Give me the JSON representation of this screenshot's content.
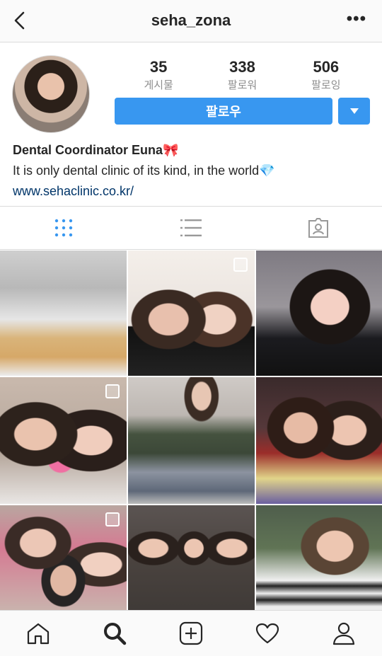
{
  "header": {
    "username": "seha_zona",
    "back_icon": "chevron-left-icon",
    "more_label": "•••"
  },
  "profile": {
    "stats": [
      {
        "value": "35",
        "label": "게시물"
      },
      {
        "value": "338",
        "label": "팔로워"
      },
      {
        "value": "506",
        "label": "팔로잉"
      }
    ],
    "follow_label": "팔로우",
    "name": "Dental Coordinator Euna🎀",
    "bio": "It is only dental clinic of its kind, in the world💎",
    "website": "www.sehaclinic.co.kr/"
  },
  "tabs": [
    {
      "icon": "grid-icon",
      "active": true
    },
    {
      "icon": "list-icon",
      "active": false
    },
    {
      "icon": "tagged-icon",
      "active": false
    }
  ],
  "posts": [
    {
      "multi": false
    },
    {
      "multi": true
    },
    {
      "multi": false
    },
    {
      "multi": true
    },
    {
      "multi": false
    },
    {
      "multi": false
    },
    {
      "multi": true
    },
    {
      "multi": false
    },
    {
      "multi": false
    }
  ],
  "bottom_nav": [
    "home-icon",
    "search-icon",
    "new-post-icon",
    "activity-icon",
    "profile-icon"
  ],
  "colors": {
    "accent": "#3897f0",
    "link": "#003569",
    "muted": "#8e8e8e",
    "border": "#dbdbdb"
  }
}
